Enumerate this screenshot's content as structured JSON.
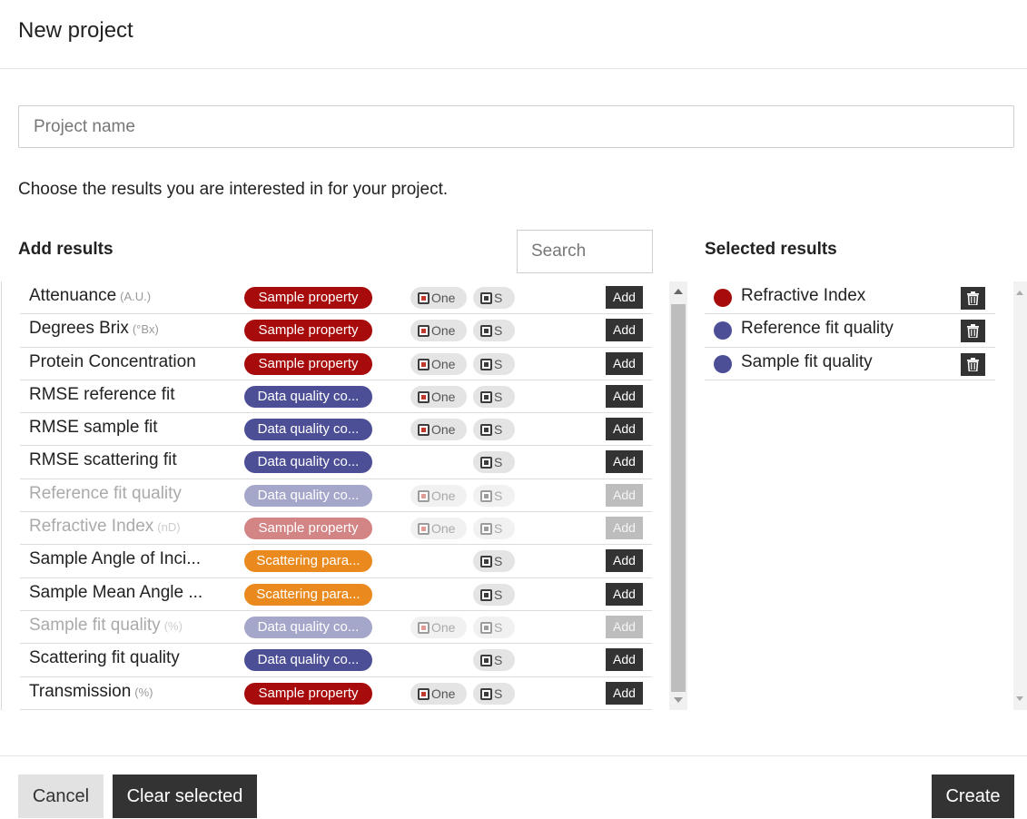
{
  "dialog": {
    "title": "New project"
  },
  "project_name": {
    "placeholder": "Project name",
    "value": ""
  },
  "instructions": "Choose the results you are interested in for your project.",
  "add_results": {
    "heading": "Add results",
    "search_placeholder": "Search",
    "chip_one_label": "One",
    "chip_s_label": "S",
    "add_label": "Add",
    "rows": [
      {
        "name": "Attenuance",
        "unit": "(A.U.)",
        "tag": "Sample property",
        "tag_kind": "sample",
        "chips": [
          "one",
          "s"
        ],
        "disabled": false
      },
      {
        "name": "Degrees Brix",
        "unit": "(°Bx)",
        "tag": "Sample property",
        "tag_kind": "sample",
        "chips": [
          "one",
          "s"
        ],
        "disabled": false
      },
      {
        "name": "Protein Concentration",
        "unit": "",
        "tag": "Sample property",
        "tag_kind": "sample",
        "chips": [
          "one",
          "s"
        ],
        "disabled": false
      },
      {
        "name": "RMSE reference fit",
        "unit": "",
        "tag": "Data quality co...",
        "tag_kind": "quality",
        "chips": [
          "one",
          "s"
        ],
        "disabled": false
      },
      {
        "name": "RMSE sample fit",
        "unit": "",
        "tag": "Data quality co...",
        "tag_kind": "quality",
        "chips": [
          "one",
          "s"
        ],
        "disabled": false
      },
      {
        "name": "RMSE scattering fit",
        "unit": "",
        "tag": "Data quality co...",
        "tag_kind": "quality",
        "chips": [
          "s"
        ],
        "disabled": false
      },
      {
        "name": "Reference fit quality",
        "unit": "",
        "tag": "Data quality co...",
        "tag_kind": "quality",
        "chips": [
          "one",
          "s"
        ],
        "disabled": true
      },
      {
        "name": "Refractive Index",
        "unit": "(nD)",
        "tag": "Sample property",
        "tag_kind": "sample",
        "chips": [
          "one",
          "s"
        ],
        "disabled": true
      },
      {
        "name": "Sample Angle of Inci...",
        "unit": "",
        "tag": "Scattering para...",
        "tag_kind": "scatter",
        "chips": [
          "s"
        ],
        "disabled": false
      },
      {
        "name": "Sample Mean Angle ...",
        "unit": "",
        "tag": "Scattering para...",
        "tag_kind": "scatter",
        "chips": [
          "s"
        ],
        "disabled": false
      },
      {
        "name": "Sample fit quality",
        "unit": "(%)",
        "tag": "Data quality co...",
        "tag_kind": "quality",
        "chips": [
          "one",
          "s"
        ],
        "disabled": true
      },
      {
        "name": "Scattering fit quality",
        "unit": "",
        "tag": "Data quality co...",
        "tag_kind": "quality",
        "chips": [
          "s"
        ],
        "disabled": false
      },
      {
        "name": "Transmission",
        "unit": "(%)",
        "tag": "Sample property",
        "tag_kind": "sample",
        "chips": [
          "one",
          "s"
        ],
        "disabled": false
      }
    ]
  },
  "selected_results": {
    "heading": "Selected results",
    "items": [
      {
        "name": "Refractive Index",
        "color": "#a80b0b"
      },
      {
        "name": "Reference fit quality",
        "color": "#4c4f96"
      },
      {
        "name": "Sample fit quality",
        "color": "#4c4f96"
      }
    ]
  },
  "footer": {
    "cancel_label": "Cancel",
    "clear_label": "Clear selected",
    "create_label": "Create"
  },
  "icons": {
    "trash": "trash-icon",
    "scroll_up": "scroll-up-icon",
    "scroll_down": "scroll-down-icon"
  }
}
